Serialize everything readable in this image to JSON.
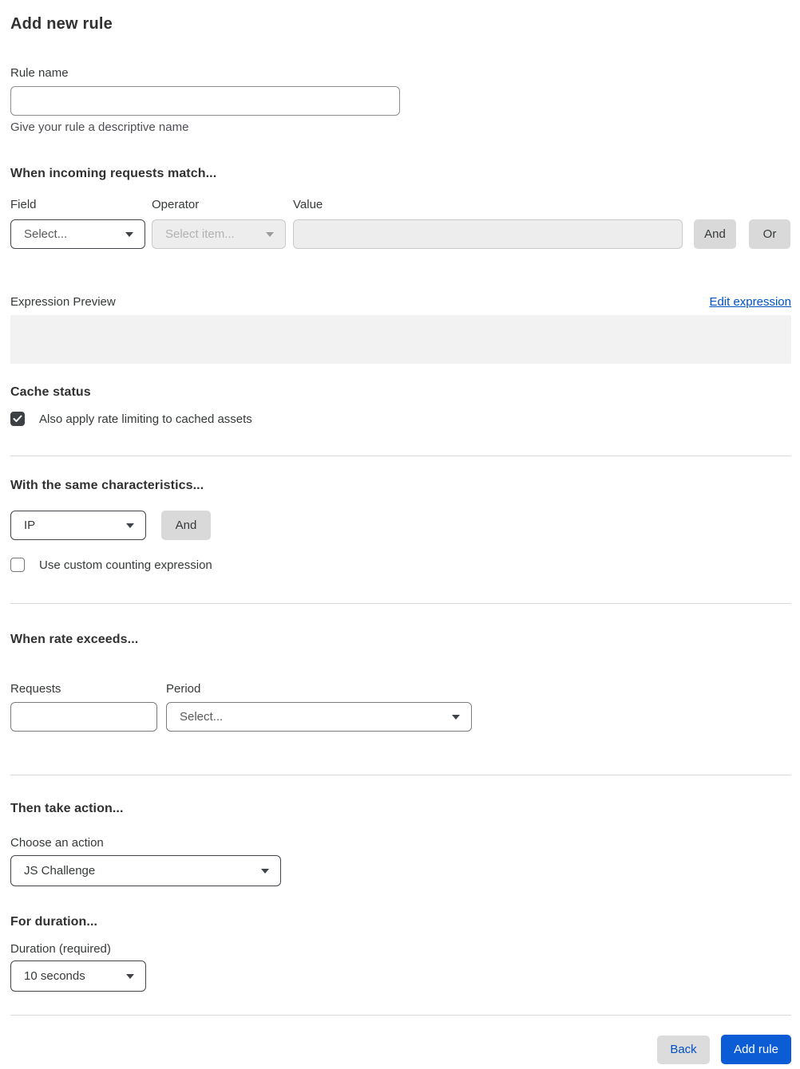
{
  "page": {
    "title": "Add new rule"
  },
  "rule_name": {
    "label": "Rule name",
    "value": "",
    "helper": "Give your rule a descriptive name"
  },
  "match": {
    "heading": "When incoming requests match...",
    "field_label": "Field",
    "operator_label": "Operator",
    "value_label": "Value",
    "field_placeholder": "Select...",
    "operator_placeholder": "Select item...",
    "value_value": "",
    "and_label": "And",
    "or_label": "Or",
    "expression_preview_label": "Expression Preview",
    "edit_expression_label": "Edit expression",
    "expression_value": ""
  },
  "cache": {
    "heading": "Cache status",
    "checkbox_label": "Also apply rate limiting to cached assets",
    "checked": true
  },
  "characteristics": {
    "heading": "With the same characteristics...",
    "selected": "IP",
    "and_label": "And",
    "custom_expression_label": "Use custom counting expression",
    "custom_expression_checked": false
  },
  "rate": {
    "heading": "When rate exceeds...",
    "requests_label": "Requests",
    "requests_value": "",
    "period_label": "Period",
    "period_placeholder": "Select..."
  },
  "action": {
    "heading": "Then take action...",
    "choose_label": "Choose an action",
    "selected": "JS Challenge"
  },
  "duration": {
    "heading": "For duration...",
    "label": "Duration (required)",
    "selected": "10 seconds"
  },
  "footer": {
    "back_label": "Back",
    "add_label": "Add rule"
  },
  "colors": {
    "link_blue": "#0051c3",
    "primary_button_blue": "#0b5cd5",
    "checkbox_checked": "#3d4042",
    "divider": "#d9d9d9",
    "disabled_bg": "#ededed",
    "preview_bg": "#f2f2f2",
    "secondary_button_gray": "#d9d9d9"
  }
}
